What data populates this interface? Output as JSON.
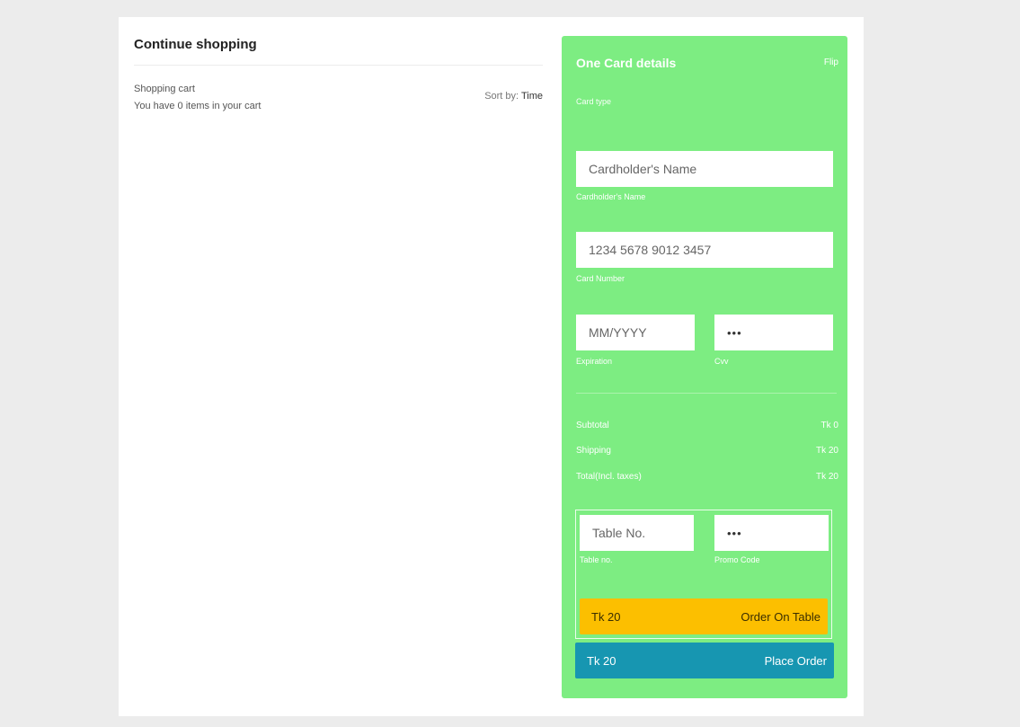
{
  "left": {
    "continue_title": "Continue shopping",
    "cart_title": "Shopping cart",
    "cart_count": "You have 0 items in your cart",
    "sort_label": "Sort by:",
    "sort_value": "Time"
  },
  "card": {
    "title": "One Card details",
    "flip": "Flip",
    "card_type_label": "Card type",
    "name_placeholder": "Cardholder's Name",
    "name_label": "Cardholder's Name",
    "number_placeholder": "1234 5678 9012 3457",
    "number_label": "Card Number",
    "expiry_placeholder": "MM/YYYY",
    "expiry_label": "Expiration",
    "cvv_value": "•••",
    "cvv_label": "Cvv"
  },
  "summary": {
    "subtotal_label": "Subtotal",
    "subtotal_value": "Tk 0",
    "shipping_label": "Shipping",
    "shipping_value": "Tk 20",
    "total_label": "Total(Incl. taxes)",
    "total_value": "Tk 20"
  },
  "table": {
    "table_placeholder": "Table No.",
    "table_label": "Table no.",
    "promo_value": "•••",
    "promo_label": "Promo Code"
  },
  "buttons": {
    "order_table_price": "Tk 20",
    "order_table_label": "Order On Table",
    "place_order_price": "Tk 20",
    "place_order_label": "Place Order"
  },
  "colors": {
    "card_bg": "#7ded82",
    "order_table_btn": "#fcbf00",
    "place_order_btn": "#1796b1",
    "page_bg": "#ececec"
  }
}
